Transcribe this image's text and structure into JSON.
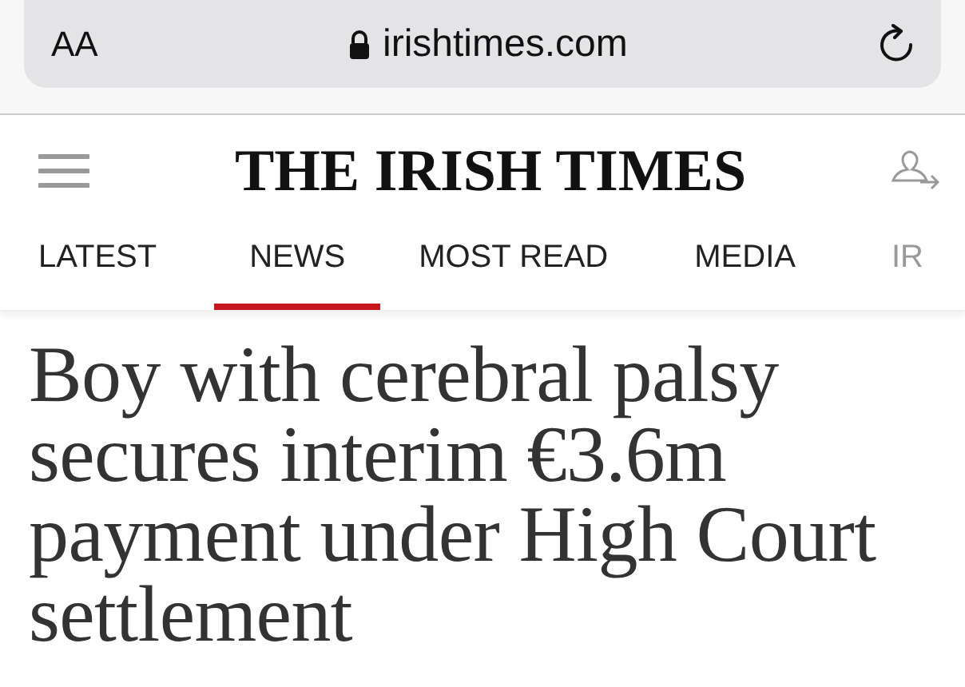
{
  "browser": {
    "text_size": "AA",
    "address": "irishtimes.com"
  },
  "header": {
    "logo": "THE IRISH TIMES"
  },
  "tabs": [
    {
      "label": "LATEST",
      "selected": false,
      "faded": false
    },
    {
      "label": "NEWS",
      "selected": true,
      "faded": false
    },
    {
      "label": "MOST READ",
      "selected": false,
      "faded": false
    },
    {
      "label": "MEDIA",
      "selected": false,
      "faded": false
    },
    {
      "label": "IR",
      "selected": false,
      "faded": true
    }
  ],
  "article": {
    "headline": "Boy with cerebral palsy secures interim €3.6m payment under High Court settlement"
  }
}
